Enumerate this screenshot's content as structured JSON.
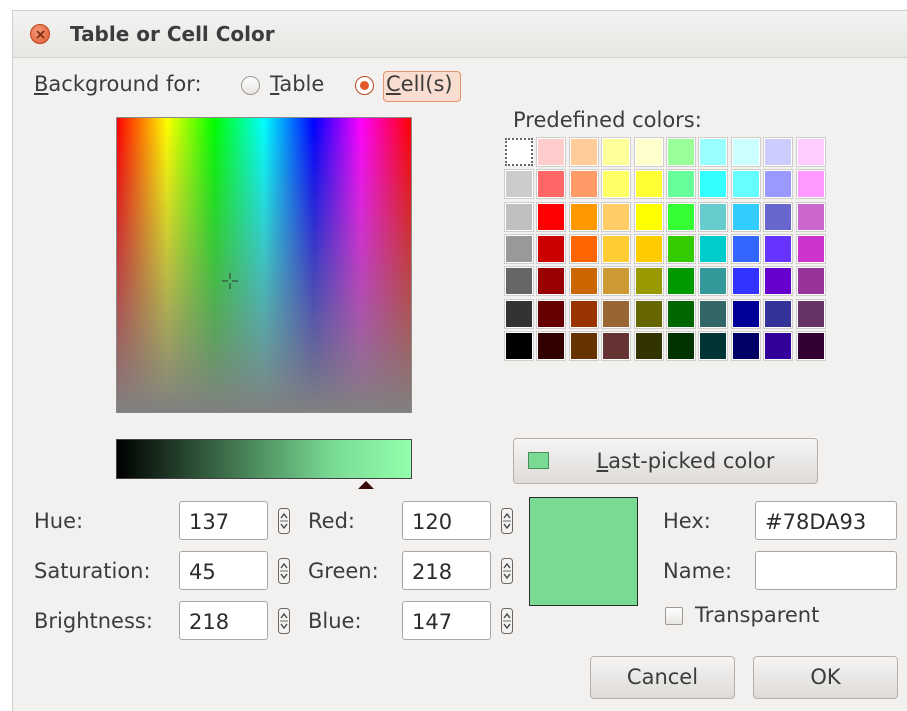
{
  "window": {
    "title": "Table or Cell Color"
  },
  "background_for": {
    "label_first": "B",
    "label_rest": "ackground for:",
    "options": [
      {
        "first": "",
        "mnemonic": "T",
        "rest": "able",
        "checked": false
      },
      {
        "first": "",
        "mnemonic": "C",
        "rest": "ell(s)",
        "checked": true
      }
    ]
  },
  "predefined": {
    "label": "Predefined colors:",
    "rows": [
      [
        "#ffffff",
        "#ffcccc",
        "#ffcc99",
        "#ffff99",
        "#ffffcc",
        "#99ff99",
        "#99ffff",
        "#ccffff",
        "#ccccff",
        "#ffccff"
      ],
      [
        "#cccccc",
        "#ff6666",
        "#ff9966",
        "#ffff66",
        "#ffff33",
        "#66ff99",
        "#33ffff",
        "#66ffff",
        "#9999ff",
        "#ff99ff"
      ],
      [
        "#c0c0c0",
        "#ff0000",
        "#ff9900",
        "#ffcc66",
        "#ffff00",
        "#33ff33",
        "#66cccc",
        "#33ccff",
        "#6666cc",
        "#cc66cc"
      ],
      [
        "#999999",
        "#cc0000",
        "#ff6600",
        "#ffcc33",
        "#ffcc00",
        "#33cc00",
        "#00cccc",
        "#3366ff",
        "#6633ff",
        "#cc33cc"
      ],
      [
        "#666666",
        "#990000",
        "#cc6600",
        "#cc9933",
        "#999900",
        "#009900",
        "#339999",
        "#3333ff",
        "#6600cc",
        "#993399"
      ],
      [
        "#333333",
        "#660000",
        "#993300",
        "#996633",
        "#666600",
        "#006600",
        "#336666",
        "#000099",
        "#333399",
        "#663366"
      ],
      [
        "#000000",
        "#330000",
        "#663300",
        "#663333",
        "#333300",
        "#003300",
        "#003333",
        "#000066",
        "#330099",
        "#330033"
      ]
    ]
  },
  "last_picked": {
    "mnemonic": "L",
    "rest": "ast-picked color",
    "color": "#78DA93"
  },
  "hsb": [
    {
      "label": "Hue:",
      "value": "137"
    },
    {
      "label": "Saturation:",
      "value": "45"
    },
    {
      "label": "Brightness:",
      "value": "218"
    }
  ],
  "rgb": [
    {
      "label": "Red:",
      "value": "120"
    },
    {
      "label": "Green:",
      "value": "218"
    },
    {
      "label": "Blue:",
      "value": "147"
    }
  ],
  "hex": {
    "label": "Hex:",
    "value": "#78DA93"
  },
  "name": {
    "label": "Name:",
    "value": ""
  },
  "transparent": {
    "label": "Transparent",
    "checked": false
  },
  "buttons": {
    "cancel": "Cancel",
    "ok": "OK"
  },
  "colors": {
    "current": "#78DA93",
    "accent": "#E2592A"
  }
}
